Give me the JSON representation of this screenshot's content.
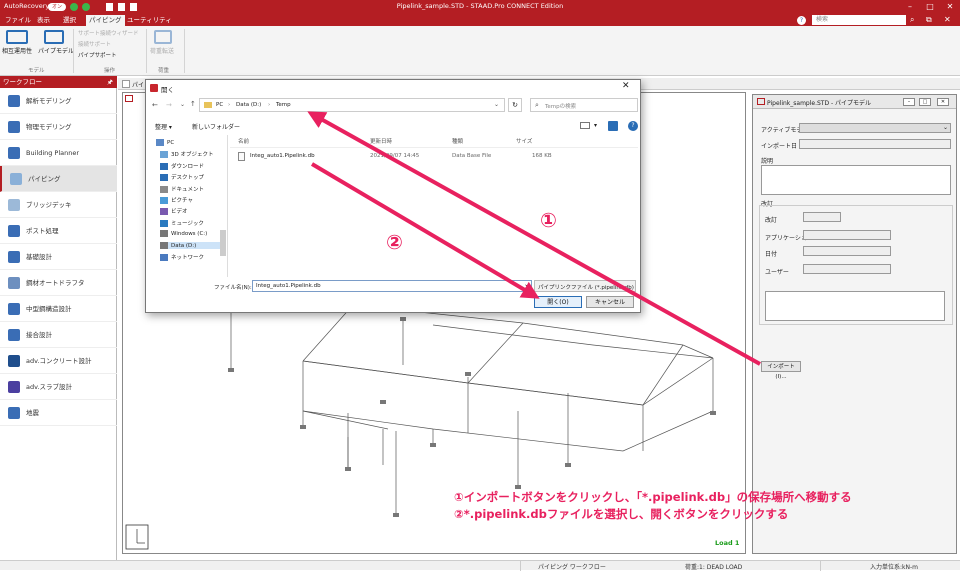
{
  "titlebar": {
    "autorecovery": "AutoRecovery",
    "toggle": "オン",
    "title": "Pipelink_sample.STD - STAAD.Pro CONNECT Edition"
  },
  "menu": {
    "tabs": [
      "ファイル",
      "表示",
      "選択",
      "パイピング",
      "ユーティリティ"
    ],
    "search_placeholder": "検索"
  },
  "ribbon": {
    "btn_interop": "相互運用性",
    "btn_pipemodel": "パイプモデル",
    "grp_model": "モデル",
    "support_wizard": "サポート接続ウィザード",
    "support_conn": "接続サポート",
    "pipe_support": "パイプサポート",
    "grp_ops": "操作",
    "btn_load": "荷重転送",
    "grp_load": "荷重"
  },
  "sidebar": {
    "header": "ワークフロー",
    "items": [
      {
        "label": "解析モデリング",
        "color": "#3a6db5"
      },
      {
        "label": "物理モデリング",
        "color": "#3a6db5"
      },
      {
        "label": "Building Planner",
        "color": "#3a6db5"
      },
      {
        "label": "パイピング",
        "color": "#8ab0d8"
      },
      {
        "label": "ブリッジデッキ",
        "color": "#9cb9d8"
      },
      {
        "label": "ポスト処理",
        "color": "#3a6db5"
      },
      {
        "label": "基礎設計",
        "color": "#3a6db5"
      },
      {
        "label": "鋼材オートドラフタ",
        "color": "#6d8fbf"
      },
      {
        "label": "中型鋼構造設計",
        "color": "#3a6db5"
      },
      {
        "label": "接合設計",
        "color": "#3a6db5"
      },
      {
        "label": "adv.コンクリート設計",
        "color": "#1f4e8c"
      },
      {
        "label": "adv.スラブ設計",
        "color": "#4b3fa0"
      },
      {
        "label": "地震",
        "color": "#3a6db5"
      }
    ]
  },
  "doctab": {
    "label": "パイ"
  },
  "viewport": {
    "load_label": "Load 1"
  },
  "rightpanel": {
    "title": "Pipelink_sample.STD - パイプモデル",
    "active_model": "アクティブモデ",
    "import_date": "インポート日",
    "description": "説明",
    "revision": "改訂",
    "rev_field": "改訂",
    "application": "アプリケーション",
    "date": "日付",
    "user": "ユーザー",
    "import_button": "インポート(I)..."
  },
  "dialog": {
    "title": "開く",
    "path": [
      "PC",
      "Data (D:)",
      "Temp"
    ],
    "search_placeholder": "Tempの検索",
    "organize": "整理 ▾",
    "new_folder": "新しいフォルダー",
    "nav_items": [
      "PC",
      "3D オブジェクト",
      "ダウンロード",
      "デスクトップ",
      "ドキュメント",
      "ピクチャ",
      "ビデオ",
      "ミュージック",
      "Windows (C:)",
      "Data (D:)",
      "ネットワーク"
    ],
    "columns": [
      "名前",
      "更新日時",
      "種類",
      "サイズ"
    ],
    "file": {
      "name": "Integ_auto1.Pipelink.db",
      "date": "2021/09/07 14:45",
      "type": "Data Base File",
      "size": "168 KB"
    },
    "filename_label": "ファイル名(N):",
    "filename_value": "Integ_auto1.Pipelink.db",
    "filter": "パイプリンクファイル (*.pipelink.db)",
    "open_button": "開く(O)",
    "cancel_button": "キャンセル"
  },
  "statusbar": {
    "workflow": "パイピング ワークフロー",
    "load": "荷重:1: DEAD LOAD",
    "units": "入力単位系:kN-m"
  },
  "annotations": {
    "marker1": "①",
    "marker2": "②",
    "line1": "①インポートボタンをクリックし、「*.pipelink.db」の保存場所へ移動する",
    "line2": "②*.pipelink.dbファイルを選択し、開くボタンをクリックする",
    "color": "#e8215f"
  }
}
